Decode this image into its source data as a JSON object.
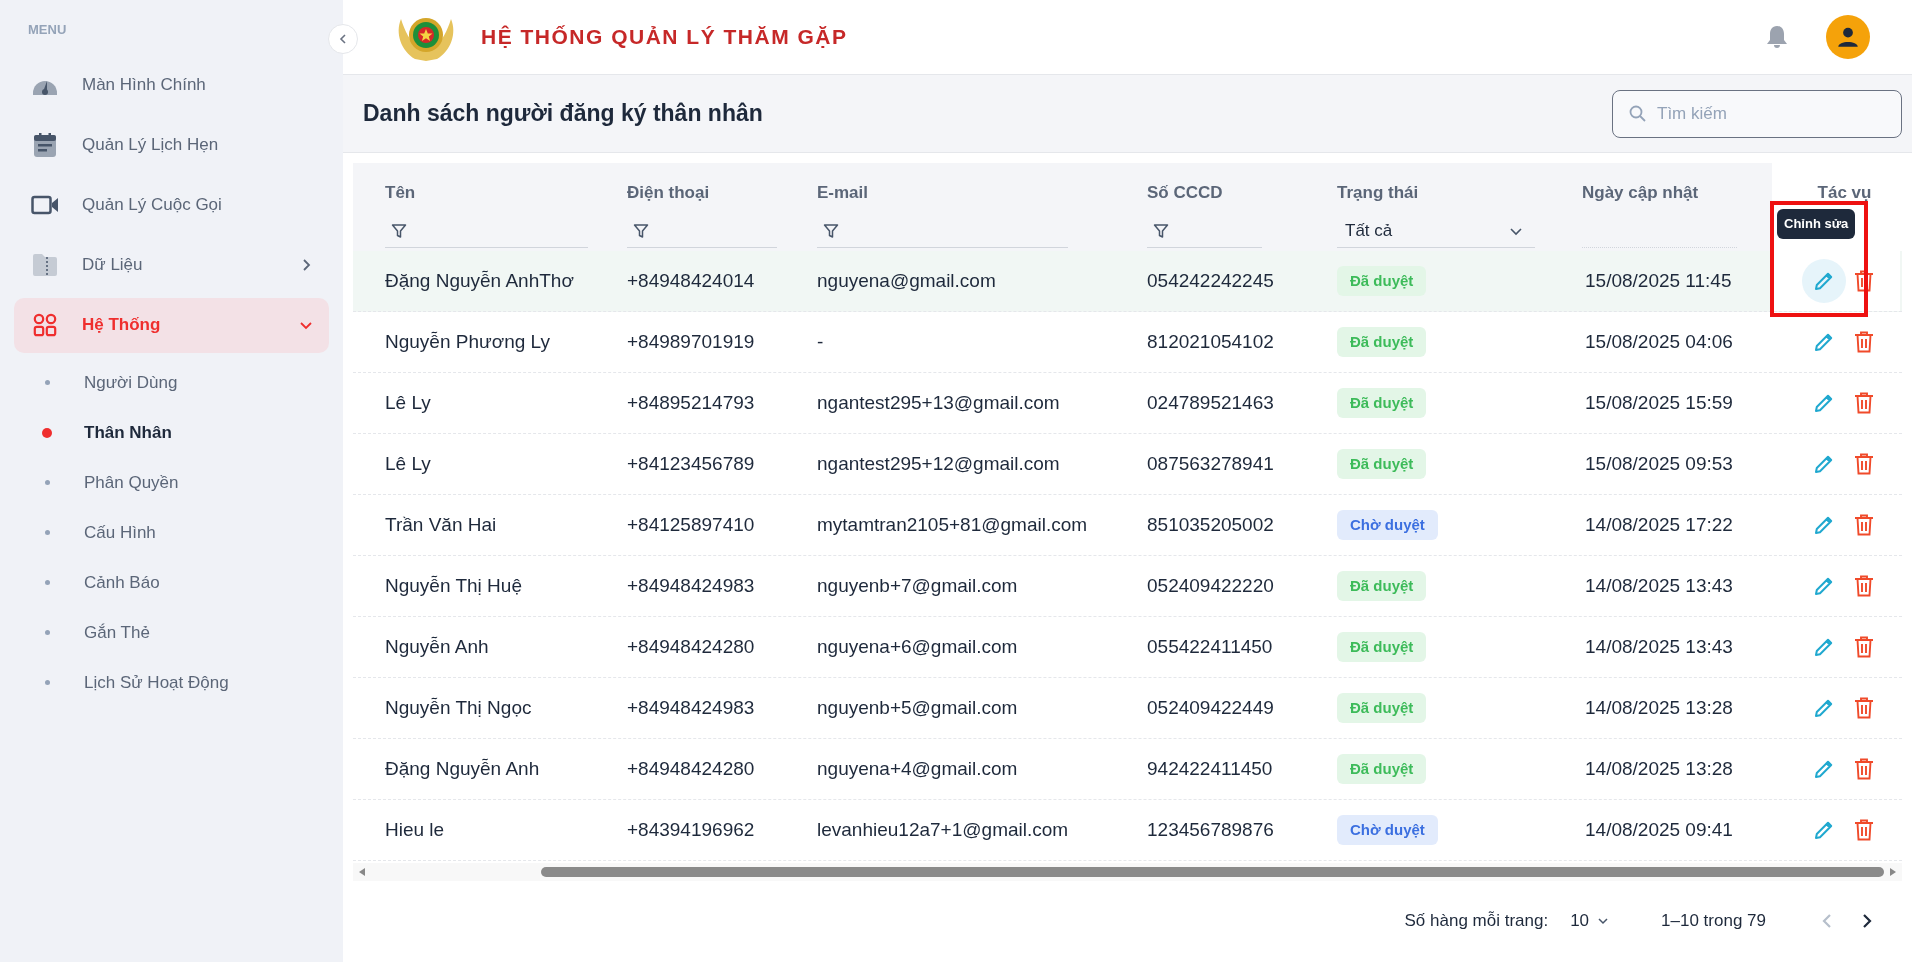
{
  "sidebar": {
    "heading": "MENU",
    "items": [
      {
        "kind": "gauge",
        "label": "Màn Hình Chính",
        "selected": false
      },
      {
        "kind": "calendar",
        "label": "Quản Lý Lịch Hẹn",
        "selected": false
      },
      {
        "kind": "video",
        "label": "Quản Lý Cuộc Gọi",
        "selected": false
      },
      {
        "kind": "folder",
        "label": "Dữ Liệu",
        "selected": false,
        "expanded": false
      },
      {
        "kind": "grid",
        "label": "Hệ Thống",
        "selected": true,
        "expanded": true,
        "children": [
          {
            "label": "Người Dùng",
            "selected": false
          },
          {
            "label": "Thân Nhân",
            "selected": true
          },
          {
            "label": "Phân Quyền",
            "selected": false
          },
          {
            "label": "Cấu Hình",
            "selected": false
          },
          {
            "label": "Cảnh Báo",
            "selected": false
          },
          {
            "label": "Gắn Thẻ",
            "selected": false
          },
          {
            "label": "Lịch Sử Hoạt Động",
            "selected": false
          }
        ]
      }
    ]
  },
  "header": {
    "title": "HỆ THỐNG QUẢN LÝ THĂM GẶP"
  },
  "page": {
    "title": "Danh sách người đăng ký thân nhân",
    "search": {
      "placeholder": "Tìm kiếm"
    }
  },
  "table": {
    "columns": [
      {
        "label": "Tên",
        "kind": "text"
      },
      {
        "label": "Điện thoại",
        "kind": "text"
      },
      {
        "label": "E-mail",
        "kind": "text"
      },
      {
        "label": "Số CCCD",
        "kind": "text"
      },
      {
        "label": "Trạng thái",
        "kind": "select",
        "value": "Tất cả"
      },
      {
        "label": "Ngày cập nhật",
        "kind": "none"
      },
      {
        "label": "Tác vụ",
        "kind": "none"
      }
    ],
    "tooltip": "Chỉnh sửa",
    "rows": [
      {
        "name": "Đặng Nguyễn AnhThơ",
        "phone": "+84948424014",
        "email": "nguyena@gmail.com",
        "cccd": "054242242245",
        "status": "Đã duyệt",
        "kind": "approved",
        "updated": "15/08/2025 11:45",
        "selected": true
      },
      {
        "name": "Nguyễn Phương Ly",
        "phone": "+84989701919",
        "email": "-",
        "cccd": "812021054102",
        "status": "Đã duyệt",
        "kind": "approved",
        "updated": "15/08/2025 04:06",
        "selected": false
      },
      {
        "name": "Lê Ly",
        "phone": "+84895214793",
        "email": "ngantest295+13@gmail.com",
        "cccd": "024789521463",
        "status": "Đã duyệt",
        "kind": "approved",
        "updated": "15/08/2025 15:59",
        "selected": false
      },
      {
        "name": "Lê Ly",
        "phone": "+84123456789",
        "email": "ngantest295+12@gmail.com",
        "cccd": "087563278941",
        "status": "Đã duyệt",
        "kind": "approved",
        "updated": "15/08/2025 09:53",
        "selected": false
      },
      {
        "name": "Trần Văn Hai",
        "phone": "+84125897410",
        "email": "mytamtran2105+81@gmail.com",
        "cccd": "851035205002",
        "status": "Chờ duyệt",
        "kind": "pending",
        "updated": "14/08/2025 17:22",
        "selected": false
      },
      {
        "name": "Nguyễn Thị Huệ",
        "phone": "+84948424983",
        "email": "nguyenb+7@gmail.com",
        "cccd": "052409422220",
        "status": "Đã duyệt",
        "kind": "approved",
        "updated": "14/08/2025 13:43",
        "selected": false
      },
      {
        "name": "Nguyễn Anh",
        "phone": "+84948424280",
        "email": "nguyena+6@gmail.com",
        "cccd": "055422411450",
        "status": "Đã duyệt",
        "kind": "approved",
        "updated": "14/08/2025 13:43",
        "selected": false
      },
      {
        "name": "Nguyễn Thị Ngọc",
        "phone": "+84948424983",
        "email": "nguyenb+5@gmail.com",
        "cccd": "052409422449",
        "status": "Đã duyệt",
        "kind": "approved",
        "updated": "14/08/2025 13:28",
        "selected": false
      },
      {
        "name": "Đặng Nguyễn Anh",
        "phone": "+84948424280",
        "email": "nguyena+4@gmail.com",
        "cccd": "942422411450",
        "status": "Đã duyệt",
        "kind": "approved",
        "updated": "14/08/2025 13:28",
        "selected": false
      },
      {
        "name": "Hieu le",
        "phone": "+84394196962",
        "email": "levanhieu12a7+1@gmail.com",
        "cccd": "123456789876",
        "status": "Chờ duyệt",
        "kind": "pending",
        "updated": "14/08/2025 09:41",
        "selected": false
      }
    ]
  },
  "pagination": {
    "rows_label": "Số hàng mỗi trang:",
    "rows_value": "10",
    "range": "1–10 trong 79",
    "prev_disabled": true,
    "next_disabled": false
  }
}
